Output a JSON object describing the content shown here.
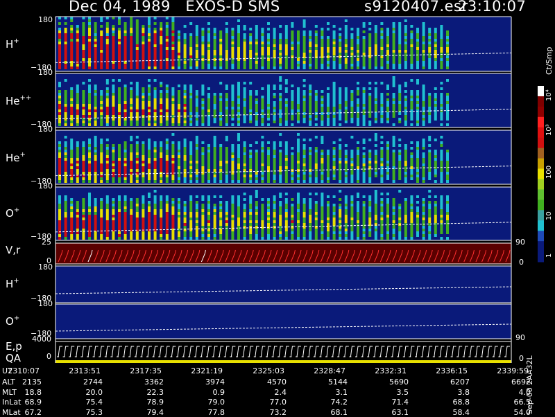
{
  "header": {
    "date_instrument": "Dec 04, 1989   EXOS-D SMS",
    "filename": "s9120407.esr",
    "time": "23:10:07"
  },
  "colors": {
    "background": "#000000",
    "plot_bg": "#0a1a7a",
    "red": "#d01010",
    "yellow": "#e8e000",
    "green": "#40b020",
    "cyan": "#20c0d0",
    "white_dash": "#ffffff"
  },
  "colorbar": {
    "unit": "Ct/Smp",
    "ticks": [
      "1",
      "10",
      "100",
      "10³",
      "10⁴"
    ],
    "colors": [
      "#0a1a7a",
      "#0a1a7a",
      "#1e4ab8",
      "#20c0d0",
      "#3aa0a0",
      "#40b020",
      "#60c030",
      "#a0d020",
      "#e8e000",
      "#c8a000",
      "#a06020",
      "#d01010",
      "#e01010",
      "#ff2020",
      "#900000",
      "#800000",
      "#ffffff"
    ]
  },
  "panels": {
    "h_plus": {
      "label": "H",
      "sup": "+",
      "top": "180",
      "bottom": "−180"
    },
    "he_pp": {
      "label": "He",
      "sup": "++",
      "top": "180",
      "bottom": "−180"
    },
    "he_plus": {
      "label": "He",
      "sup": "+",
      "top": "180",
      "bottom": "−180"
    },
    "o_plus": {
      "label": "O",
      "sup": "+",
      "top": "180",
      "bottom": "−180"
    },
    "vr": {
      "label": "V,r",
      "top": "25",
      "bottom": "0",
      "r_top": "90",
      "r_bottom": "0"
    },
    "h_plus2": {
      "label": "H",
      "sup": "+",
      "top": "180",
      "bottom": "−180"
    },
    "o_plus2": {
      "label": "O",
      "sup": "+",
      "top": "180",
      "bottom": "−180"
    },
    "ep": {
      "label": "E,p",
      "label2": "QA",
      "top": "4000",
      "bottom": "0",
      "r_top": "90",
      "r_bottom": "0"
    }
  },
  "footer": {
    "rows": [
      {
        "name": "UT",
        "values": [
          "2310:07",
          "2313:51",
          "2317:35",
          "2321:19",
          "2325:03",
          "2328:47",
          "2332:31",
          "2336:15",
          "2339:59"
        ]
      },
      {
        "name": "ALT",
        "values": [
          "2135",
          "2744",
          "3362",
          "3974",
          "4570",
          "5144",
          "5690",
          "6207",
          "6692"
        ]
      },
      {
        "name": "MLT",
        "values": [
          "18.8",
          "20.0",
          "22.3",
          "0.9",
          "2.4",
          "3.1",
          "3.5",
          "3.8",
          "4.0"
        ]
      },
      {
        "name": "InLat",
        "values": [
          "68.9",
          "75.4",
          "78.9",
          "79.0",
          "77.0",
          "74.2",
          "71.4",
          "68.8",
          "66.5"
        ]
      },
      {
        "name": "MLat",
        "values": [
          "67.2",
          "75.3",
          "79.4",
          "77.8",
          "73.2",
          "68.1",
          "63.1",
          "58.4",
          "54.0"
        ]
      }
    ],
    "side_label": "Sep-00  2AA32L"
  },
  "chart_data": {
    "type": "heatmap",
    "title": "Dec 04, 1989   EXOS-D SMS",
    "xlabel": "UT",
    "x_ticks": [
      "2310:07",
      "2313:51",
      "2317:35",
      "2321:19",
      "2325:03",
      "2328:47",
      "2332:31",
      "2336:15",
      "2339:59"
    ],
    "panels": [
      "H+",
      "He++",
      "He+",
      "O+",
      "V,r",
      "H+",
      "O+",
      "E,p QA"
    ],
    "ylim_angle": [
      -180,
      180
    ],
    "colorbar_range": [
      1,
      10000
    ],
    "colorbar_scale": "log"
  }
}
